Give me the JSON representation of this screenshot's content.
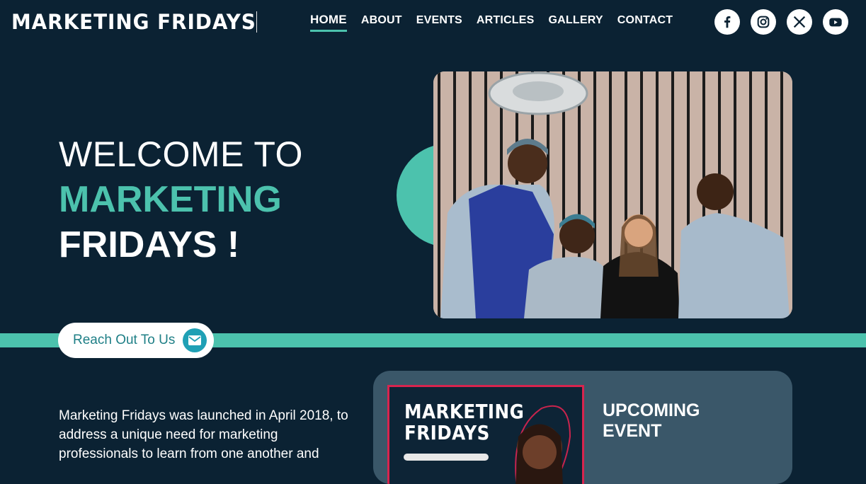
{
  "header": {
    "logo": "MARKETING FRIDAYS",
    "nav": [
      {
        "label": "HOME",
        "active": true
      },
      {
        "label": "ABOUT"
      },
      {
        "label": "EVENTS"
      },
      {
        "label": "ARTICLES"
      },
      {
        "label": "GALLERY"
      },
      {
        "label": "CONTACT"
      }
    ],
    "socials": [
      "facebook-icon",
      "instagram-icon",
      "x-icon",
      "youtube-icon"
    ]
  },
  "hero": {
    "line1": "WELCOME TO",
    "line2": "MARKETING",
    "line3": "FRIDAYS !",
    "button_label": "Reach Out To Us",
    "button_icon": "envelope-icon"
  },
  "about": {
    "text": "Marketing Fridays was launched in April 2018, to address a unique need for marketing professionals to learn from one another and"
  },
  "event": {
    "poster_title_line1": "MARKETING",
    "poster_title_line2": "FRIDAYS",
    "heading_line1": "UPCOMING",
    "heading_line2": "EVENT"
  },
  "colors": {
    "background": "#0b2233",
    "accent": "#4cc2ad",
    "card": "#3a5769",
    "poster_border": "#d8244e"
  }
}
